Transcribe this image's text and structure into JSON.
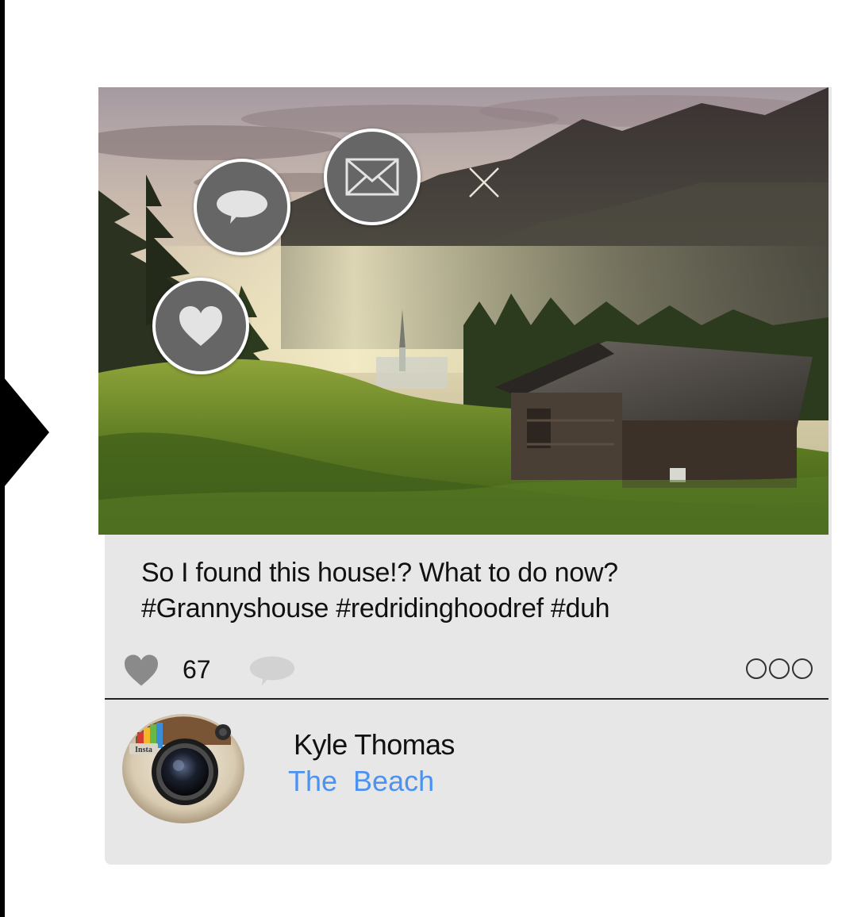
{
  "post": {
    "caption_line1": "So I found this house!? What to do now?",
    "caption_line2": "#Grannyshouse #redridinghoodref #duh",
    "like_count": "67"
  },
  "user": {
    "name": "Kyle Thomas",
    "location": "The  Beach",
    "avatar_badge": "Insta"
  },
  "actions": {
    "heart_icon": "heart-icon",
    "comment_icon": "speech-bubble-icon",
    "mail_icon": "envelope-icon",
    "close_icon": "close-icon",
    "more_icon": "more-dots-icon"
  },
  "colors": {
    "card_bg": "#e7e7e7",
    "fab_bg": "#666666",
    "location_link": "#4c92f0",
    "icon_gray": "#8a8a8a"
  }
}
